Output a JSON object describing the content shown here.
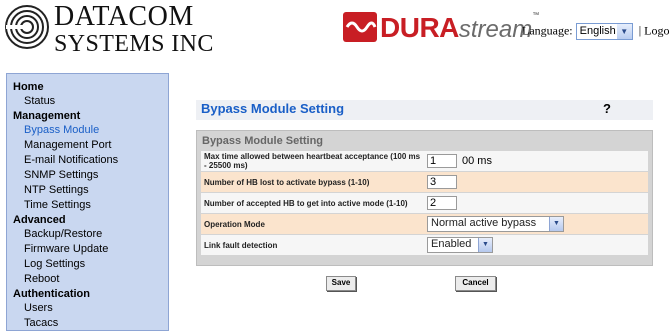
{
  "header": {
    "company_line1": "DATACOM",
    "company_line2": "SYSTEMS INC",
    "logo_icon": "datacom-rings-logo",
    "brand_icon": "durastream-wave-icon",
    "brand_dura": "DURA",
    "brand_stream": "stream",
    "brand_tm": "™",
    "language_label": "Language:",
    "language_value": "English",
    "separator": "|",
    "logout": "Logout"
  },
  "sidebar": {
    "sections": [
      {
        "label": "Home",
        "items": [
          {
            "label": "Status"
          }
        ]
      },
      {
        "label": "Management",
        "items": [
          {
            "label": "Bypass Module",
            "active": true
          },
          {
            "label": "Management Port"
          },
          {
            "label": "E-mail Notifications"
          },
          {
            "label": "SNMP Settings"
          },
          {
            "label": "NTP Settings"
          },
          {
            "label": "Time Settings"
          }
        ]
      },
      {
        "label": "Advanced",
        "items": [
          {
            "label": "Backup/Restore"
          },
          {
            "label": "Firmware Update"
          },
          {
            "label": "Log Settings"
          },
          {
            "label": "Reboot"
          }
        ]
      },
      {
        "label": "Authentication",
        "items": [
          {
            "label": "Users"
          },
          {
            "label": "Tacacs"
          }
        ]
      }
    ],
    "active_color": "#1a5fc7"
  },
  "main": {
    "title": "Bypass Module Setting",
    "help": "?",
    "panel_title": "Bypass Module Setting",
    "fields": [
      {
        "label": "Max time allowed between heartbeat acceptance (100 ms - 25500 ms)",
        "value": "1",
        "unit": "00 ms"
      },
      {
        "label": "Number of HB lost to activate bypass (1-10)",
        "value": "3"
      },
      {
        "label": "Number of accepted HB to get into active mode (1-10)",
        "value": "2"
      },
      {
        "label": "Operation Mode",
        "value": "Normal active bypass"
      },
      {
        "label": "Link fault detection",
        "value": "Enabled"
      }
    ],
    "save_label": "Save",
    "cancel_label": "Cancel"
  },
  "colors": {
    "brand_red": "#c81e24",
    "sidebar_bg": "#c9d7f0",
    "row_highlight": "#fbe4cd",
    "title_blue": "#1a5fc7"
  }
}
